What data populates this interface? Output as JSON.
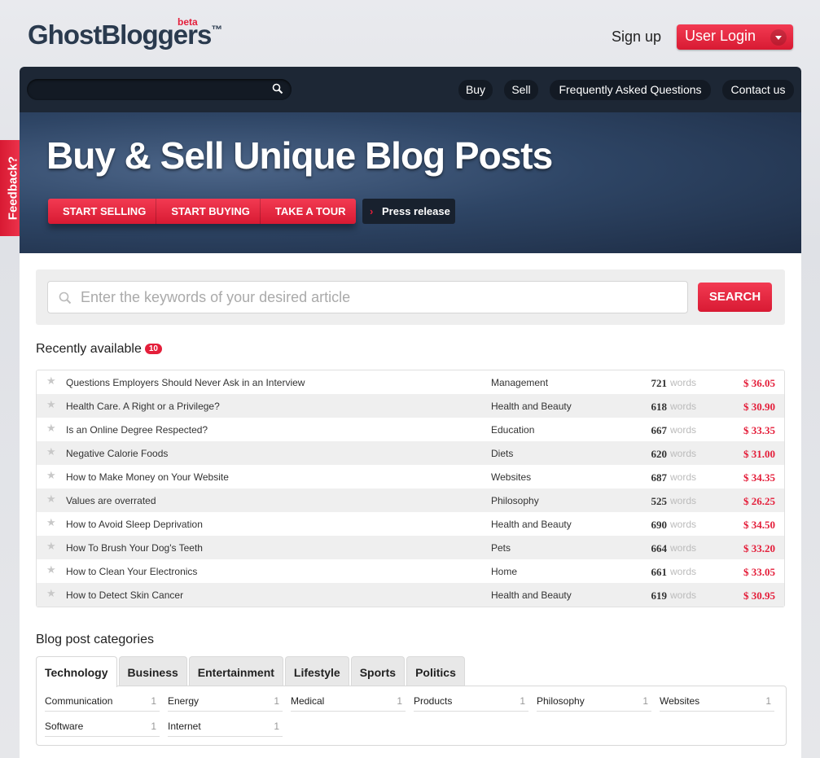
{
  "header": {
    "logo_text": "GhostBloggers",
    "logo_tm": "™",
    "logo_badge": "beta",
    "signup": "Sign up",
    "login": "User Login"
  },
  "nav": {
    "search_placeholder": "",
    "links": [
      "Buy",
      "Sell",
      "Frequently Asked Questions",
      "Contact us"
    ]
  },
  "hero": {
    "headline": "Buy & Sell Unique Blog Posts",
    "buttons": [
      "START SELLING",
      "START BUYING",
      "TAKE A TOUR"
    ],
    "press_release": "Press release"
  },
  "search": {
    "placeholder": "Enter the keywords of your desired article",
    "button": "SEARCH"
  },
  "recent": {
    "title": "Recently available",
    "count": "10",
    "words_label": "words",
    "rows": [
      {
        "title": "Questions Employers Should Never Ask in an Interview",
        "category": "Management",
        "words": "721",
        "price": "$ 36.05"
      },
      {
        "title": "Health Care. A Right or a Privilege?",
        "category": "Health and Beauty",
        "words": "618",
        "price": "$ 30.90"
      },
      {
        "title": "Is an Online Degree Respected?",
        "category": "Education",
        "words": "667",
        "price": "$ 33.35"
      },
      {
        "title": "Negative Calorie Foods",
        "category": "Diets",
        "words": "620",
        "price": "$ 31.00"
      },
      {
        "title": "How to Make Money on Your Website",
        "category": "Websites",
        "words": "687",
        "price": "$ 34.35"
      },
      {
        "title": "Values are overrated",
        "category": "Philosophy",
        "words": "525",
        "price": "$ 26.25"
      },
      {
        "title": "How to Avoid Sleep Deprivation",
        "category": "Health and Beauty",
        "words": "690",
        "price": "$ 34.50"
      },
      {
        "title": "How To Brush Your Dog's Teeth",
        "category": "Pets",
        "words": "664",
        "price": "$ 33.20"
      },
      {
        "title": "How to Clean Your Electronics",
        "category": "Home",
        "words": "661",
        "price": "$ 33.05"
      },
      {
        "title": "How to Detect Skin Cancer",
        "category": "Health and Beauty",
        "words": "619",
        "price": "$ 30.95"
      }
    ]
  },
  "categories": {
    "title": "Blog post categories",
    "tabs": [
      "Technology",
      "Business",
      "Entertainment",
      "Lifestyle",
      "Sports",
      "Politics"
    ],
    "active_tab": "Technology",
    "items": [
      {
        "name": "Communication",
        "count": "1"
      },
      {
        "name": "Energy",
        "count": "1"
      },
      {
        "name": "Medical",
        "count": "1"
      },
      {
        "name": "Products",
        "count": "1"
      },
      {
        "name": "Philosophy",
        "count": "1"
      },
      {
        "name": "Websites",
        "count": "1"
      },
      {
        "name": "Software",
        "count": "1"
      },
      {
        "name": "Internet",
        "count": "1"
      }
    ]
  },
  "feedback": "Feedback?",
  "colors": {
    "accent": "#e41e3a",
    "navbar": "#1d2735",
    "hero": "#2e4565"
  },
  "icons": {
    "search": "magnifier-icon",
    "star": "star-icon",
    "caret": "chevron-down-icon",
    "press": "chevron-right-icon"
  }
}
